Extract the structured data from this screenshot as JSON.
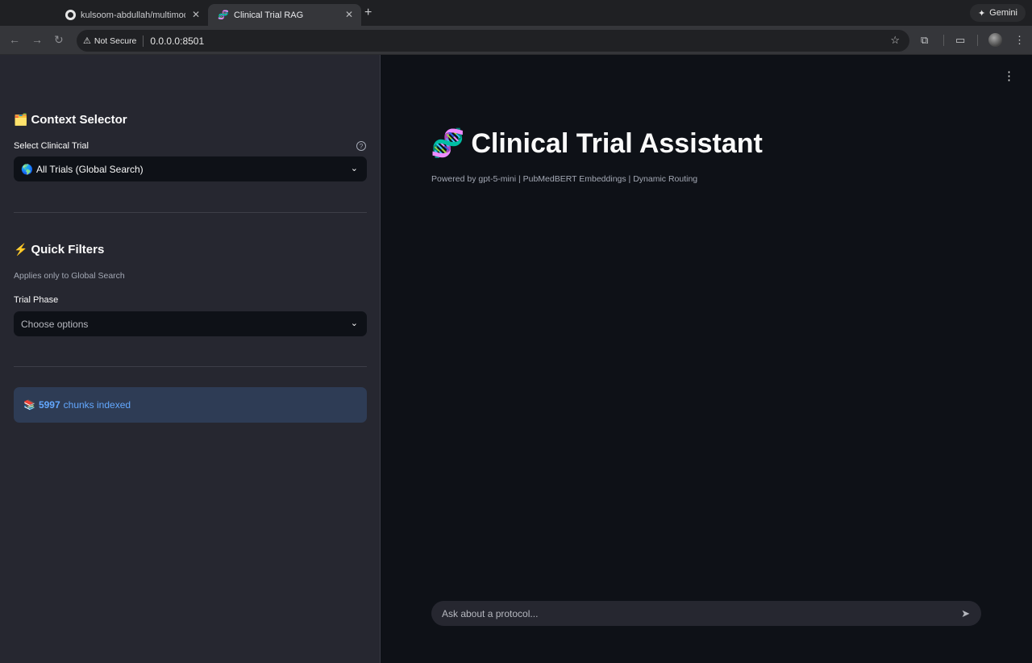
{
  "browser": {
    "tabs": [
      {
        "title": "kulsoom-abdullah/multimodal",
        "favicon": "github-icon"
      },
      {
        "title": "Clinical Trial RAG",
        "favicon": "dna-icon",
        "active": true
      }
    ],
    "new_tab": "+",
    "gemini_label": "Gemini",
    "security_label": "Not Secure",
    "url": "0.0.0.0:8501"
  },
  "sidebar": {
    "context": {
      "title": "Context Selector",
      "icon": "🗂️",
      "select_label": "Select Clinical Trial",
      "help": "?",
      "selected_icon": "🌎",
      "selected": "All Trials (Global Search)"
    },
    "filters": {
      "title": "Quick Filters",
      "icon": "⚡",
      "caption": "Applies only to Global Search",
      "phase_label": "Trial Phase",
      "phase_placeholder": "Choose options"
    },
    "status": {
      "icon": "📚",
      "count": "5997",
      "text": "chunks indexed"
    }
  },
  "main": {
    "title_icon": "🧬",
    "title": "Clinical Trial Assistant",
    "subtitle": "Powered by gpt-5-mini | PubMedBERT Embeddings | Dynamic Routing",
    "chat_placeholder": "Ask about a protocol..."
  }
}
